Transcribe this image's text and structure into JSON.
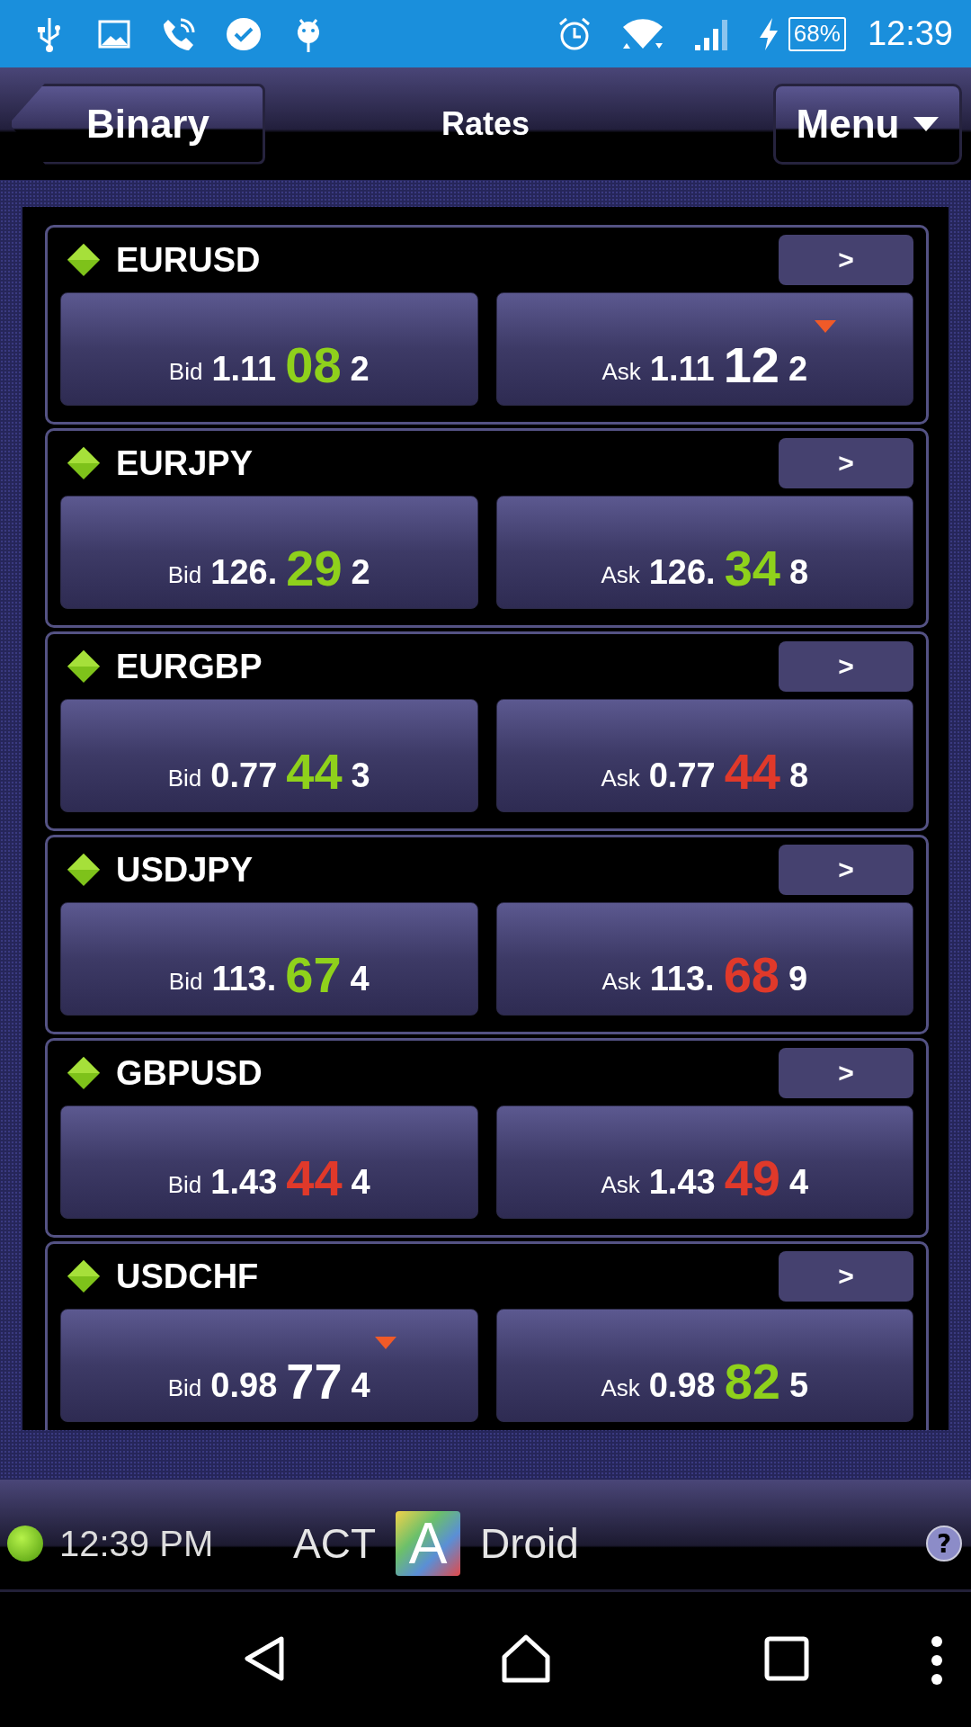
{
  "status_bar": {
    "battery": "68%",
    "time": "12:39"
  },
  "header": {
    "back_button": "Binary",
    "title": "Rates",
    "menu_button": "Menu"
  },
  "rates": [
    {
      "symbol": "EURUSD",
      "open_button": ">",
      "bid": {
        "label": "Bid",
        "base": "1.11",
        "pips": "08",
        "last": "2",
        "color": "#8fd11b",
        "marker": false
      },
      "ask": {
        "label": "Ask",
        "base": "1.11",
        "pips": "12",
        "last": "2",
        "color": "#ffffff",
        "marker": true
      }
    },
    {
      "symbol": "EURJPY",
      "open_button": ">",
      "bid": {
        "label": "Bid",
        "base": "126.",
        "pips": "29",
        "last": "2",
        "color": "#8fd11b",
        "marker": false
      },
      "ask": {
        "label": "Ask",
        "base": "126.",
        "pips": "34",
        "last": "8",
        "color": "#8fd11b",
        "marker": false
      }
    },
    {
      "symbol": "EURGBP",
      "open_button": ">",
      "bid": {
        "label": "Bid",
        "base": "0.77",
        "pips": "44",
        "last": "3",
        "color": "#8fd11b",
        "marker": false
      },
      "ask": {
        "label": "Ask",
        "base": "0.77",
        "pips": "44",
        "last": "8",
        "color": "#e0392a",
        "marker": false
      }
    },
    {
      "symbol": "USDJPY",
      "open_button": ">",
      "bid": {
        "label": "Bid",
        "base": "113.",
        "pips": "67",
        "last": "4",
        "color": "#8fd11b",
        "marker": false
      },
      "ask": {
        "label": "Ask",
        "base": "113.",
        "pips": "68",
        "last": "9",
        "color": "#e0392a",
        "marker": false
      }
    },
    {
      "symbol": "GBPUSD",
      "open_button": ">",
      "bid": {
        "label": "Bid",
        "base": "1.43",
        "pips": "44",
        "last": "4",
        "color": "#e0392a",
        "marker": false
      },
      "ask": {
        "label": "Ask",
        "base": "1.43",
        "pips": "49",
        "last": "4",
        "color": "#e0392a",
        "marker": false
      }
    },
    {
      "symbol": "USDCHF",
      "open_button": ">",
      "bid": {
        "label": "Bid",
        "base": "0.98",
        "pips": "77",
        "last": "4",
        "color": "#ffffff",
        "marker": true
      },
      "ask": {
        "label": "Ask",
        "base": "0.98",
        "pips": "82",
        "last": "5",
        "color": "#8fd11b",
        "marker": false
      }
    }
  ],
  "footer": {
    "time": "12:39 PM",
    "brand_left": "ACT",
    "logo_letter": "A",
    "brand_right": "Droid",
    "help": "?"
  }
}
